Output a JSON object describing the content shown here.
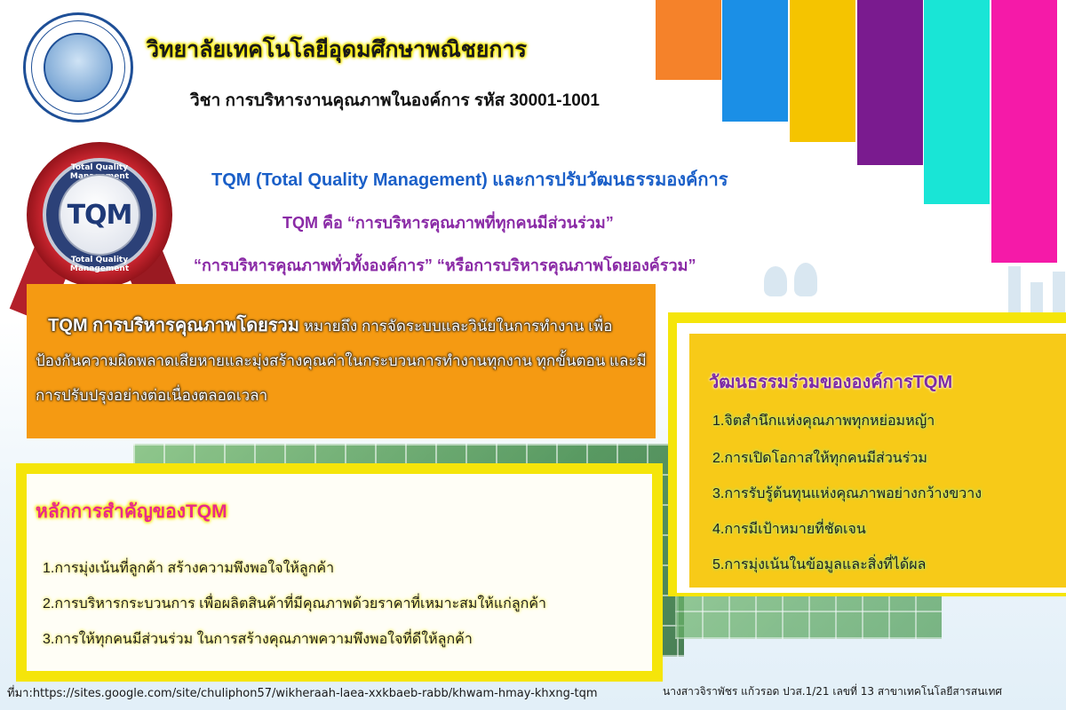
{
  "header": {
    "college_name": "วิทยาลัยเทคโนโลยีอุดมศึกษาพณิชยการ",
    "subject_line": "วิชา การบริหารงานคุณภาพในองค์การ รหัส 30001-1001",
    "logo_icon": "college-logo-icon"
  },
  "badge": {
    "center_text": "TQM",
    "arc_top": "Total Quality Management",
    "arc_bottom": "Total Quality Management"
  },
  "color_bars": [
    "#f5822a",
    "#1b8fe6",
    "#f5c400",
    "#7a1b8f",
    "#19e5d6",
    "#f51aa8"
  ],
  "intro": {
    "title": "TQM (Total Quality Management) และการปรับวัฒนธรรมองค์การ",
    "definition_1": "TQM คือ “การบริหารคุณภาพที่ทุกคนมีส่วนร่วม”",
    "definition_2": "“การบริหารคุณภาพทั่วทั้งองค์การ” “หรือการบริหารคุณภาพโดยองค์รวม”"
  },
  "definition_box": {
    "term": "TQM การบริหารคุณภาพโดยรวม",
    "text": " หมายถึง การจัดระบบและวินัยในการทำงาน เพื่อป้องกันความผิดพลาดเสียหายและมุ่งสร้างคุณค่าในกระบวนการทำงานทุกงาน ทุกขั้นตอน และมีการปรับปรุงอย่างต่อเนื่องตลอดเวลา"
  },
  "principles": {
    "title": "หลักการสำคัญของTQM",
    "items": [
      "1.การมุ่งเน้นที่ลูกค้า สร้างความพึงพอใจให้ลูกค้า",
      "2.การบริหารกระบวนการ เพื่อผลิตสินค้าที่มีคุณภาพด้วยราคาที่เหมาะสมให้แก่ลูกค้า",
      "3.การให้ทุกคนมีส่วนร่วม ในการสร้างคุณภาพความพึงพอใจที่ดีให้ลูกค้า"
    ]
  },
  "culture": {
    "title": "วัฒนธรรมร่วมขององค์การTQM",
    "items": [
      "1.จิตสำนึกแห่งคุณภาพทุกหย่อมหญ้า",
      "2.การเปิดโอกาสให้ทุกคนมีส่วนร่วม",
      "3.การรับรู้ต้นทุนแห่งคุณภาพอย่างกว้างขวาง",
      "4.การมีเป้าหมายที่ชัดเจน",
      "5.การมุ่งเน้นในข้อมูลและสิ่งที่ได้ผล"
    ]
  },
  "footer": {
    "source": "ที่มา:https://sites.google.com/site/chuliphon57/wikheraah-laea-xxkbaeb-rabb/khwam-hmay-khxng-tqm",
    "author": "นางสาวจิราพัชร แก้วรอด ปวส.1/21 เลขที่ 13 สาขาเทคโนโลยีสารสนเทศ"
  }
}
